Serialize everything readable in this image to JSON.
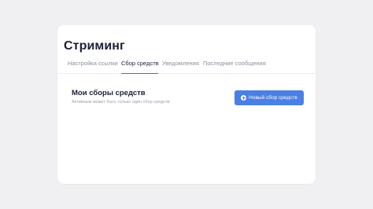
{
  "page": {
    "title": "Стриминг"
  },
  "tabs": [
    {
      "label": "Настройка ссылки",
      "active": false
    },
    {
      "label": "Сбор средств",
      "active": true
    },
    {
      "label": "Уведомления",
      "active": false
    },
    {
      "label": "Последние сообщения",
      "active": false
    }
  ],
  "fundraising": {
    "title": "Мои сборы средств",
    "subtitle": "Активным может быть только один сбор средств",
    "new_button_label": "Новый сбор средств",
    "new_button_icon": "plus-circle-icon"
  },
  "colors": {
    "accent": "#4a7fe4",
    "tab_underline": "#3b6fd8",
    "background": "#f0f0f2",
    "card": "#ffffff"
  }
}
